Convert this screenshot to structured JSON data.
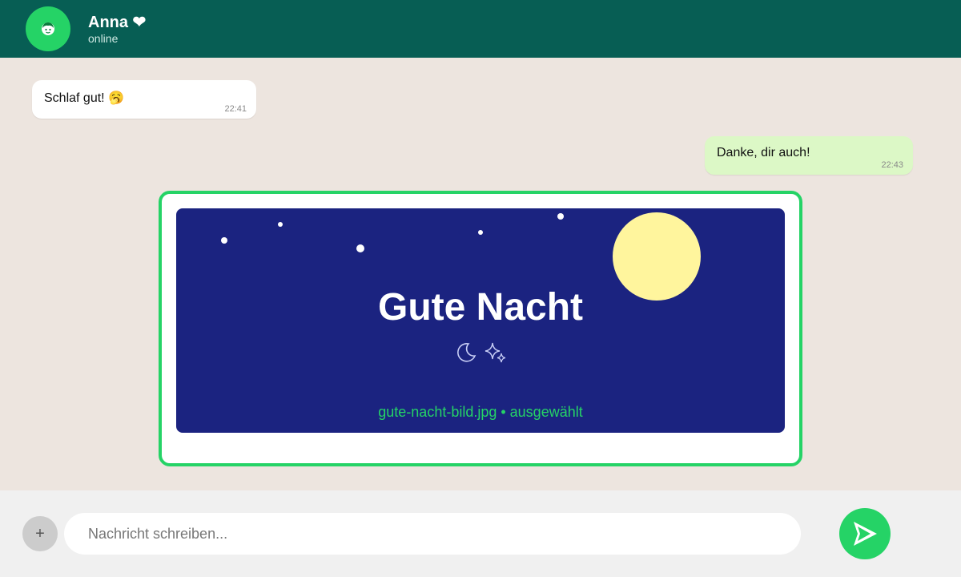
{
  "header": {
    "contact_name": "Anna ❤",
    "status": "online",
    "avatar_icon": "girl-face-icon"
  },
  "messages": [
    {
      "direction": "incoming",
      "text": "Schlaf gut! 🥱",
      "time": "22:41"
    },
    {
      "direction": "outgoing",
      "text": "Danke, dir auch!",
      "time": "22:43"
    }
  ],
  "attachment_preview": {
    "title": "Gute Nacht",
    "icons": [
      "crescent-moon-icon",
      "sparkles-icon"
    ],
    "caption": "gute-nacht-bild.jpg • ausgewählt"
  },
  "input_bar": {
    "attach_label": "+",
    "placeholder": "Nachricht schreiben...",
    "send_icon": "send-icon"
  },
  "colors": {
    "header": "#075e54",
    "accent": "#25d366",
    "chat_background": "#ede5df",
    "outgoing_bubble": "#dcf8c6",
    "image_background": "#1b2380",
    "moon": "#fff59d"
  }
}
